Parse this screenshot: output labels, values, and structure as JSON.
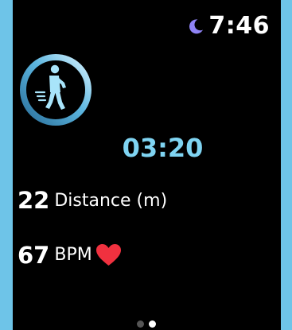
{
  "status": {
    "time": "7:46",
    "icon": "moon-icon",
    "icon_color": "#8f83f5"
  },
  "workout": {
    "icon": "walking-person-icon",
    "elapsed": "03:20",
    "accent_color": "#7fd4f2"
  },
  "stats": {
    "distance": {
      "value": "22",
      "label": "Distance (m)"
    },
    "heart_rate": {
      "value": "67",
      "label": "BPM",
      "icon": "heart-icon",
      "icon_color": "#f0313f"
    }
  },
  "pagination": {
    "count": 2,
    "current": 2
  }
}
